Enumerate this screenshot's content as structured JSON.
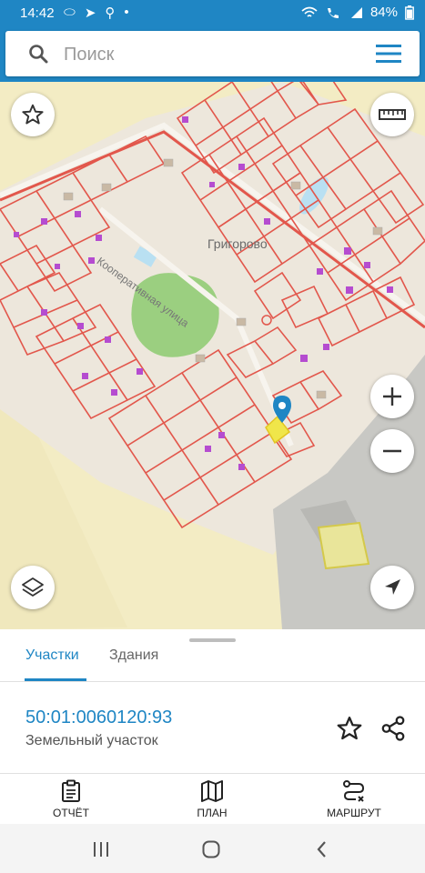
{
  "status_bar": {
    "time": "14:42",
    "battery": "84%"
  },
  "search": {
    "placeholder": "Поиск"
  },
  "map": {
    "place_name": "Григорово",
    "street_name": "Кооперативная улица"
  },
  "tabs": [
    {
      "label": "Участки",
      "active": true
    },
    {
      "label": "Здания",
      "active": false
    }
  ],
  "parcel": {
    "number": "50:01:0060120:93",
    "type": "Земельный участок"
  },
  "bottom_nav": [
    {
      "label": "ОТЧЁТ",
      "icon": "report-icon"
    },
    {
      "label": "ПЛАН",
      "icon": "map-icon"
    },
    {
      "label": "МАРШРУТ",
      "icon": "route-icon"
    }
  ],
  "colors": {
    "accent": "#1f86c4",
    "parcel_border": "#e2574c",
    "map_bg": "#f3ecc4",
    "selected": "#f0e64a",
    "building": "#b54cd0"
  }
}
